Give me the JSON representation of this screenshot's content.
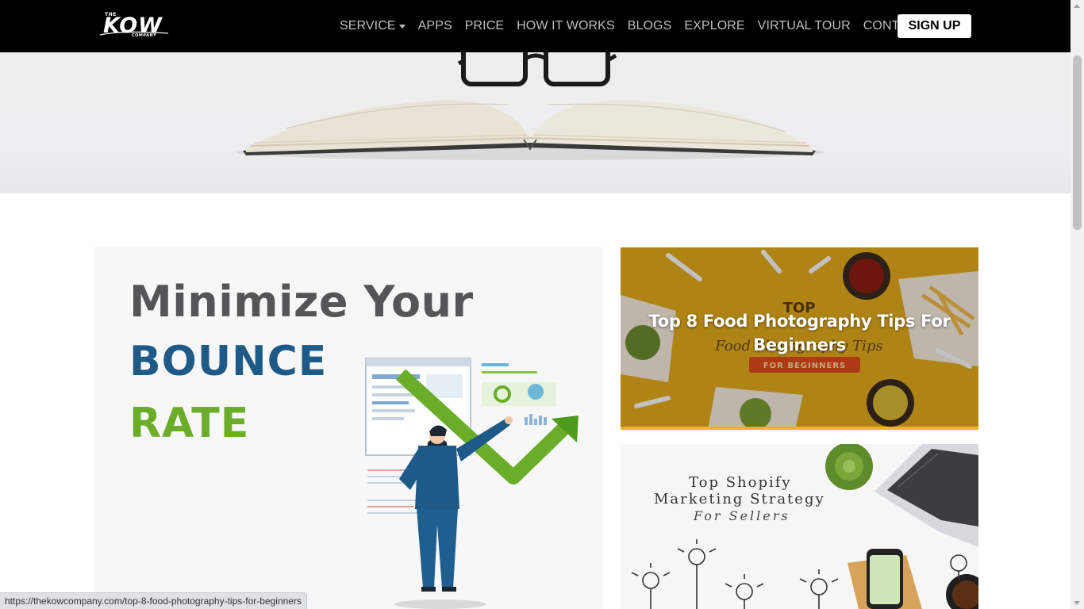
{
  "navbar": {
    "logo": {
      "the": "THE",
      "name": "KOW",
      "company": "COMPANY"
    },
    "links": [
      {
        "label": "SERVICE",
        "has_dropdown": true
      },
      {
        "label": "APPS"
      },
      {
        "label": "PRICE"
      },
      {
        "label": "HOW IT WORKS"
      },
      {
        "label": "BLOGS"
      },
      {
        "label": "EXPLORE"
      },
      {
        "label": "VIRTUAL TOUR"
      },
      {
        "label": "CONTACT"
      }
    ],
    "signup_label": "SIGN UP"
  },
  "hero": {
    "image": "open-book-with-glasses"
  },
  "main_post": {
    "line1": "Minimize Your",
    "line2": "BOUNCE",
    "line3": "RATE",
    "colors": {
      "line1": "#555558",
      "line2": "#1e5a87",
      "line3": "#6aad29"
    }
  },
  "side_posts": [
    {
      "title": "Top 8 Food Photography Tips For Beginners",
      "image_text": "TOP",
      "image_sub": "Food Photography Tips",
      "badge": "FOR BEGINNERS"
    },
    {
      "line1": "Top Shopify",
      "line2": "Marketing Strategy",
      "line3": "For Sellers"
    }
  ],
  "status_bar": {
    "url": "https://thekowcompany.com/top-8-food-photography-tips-for-beginners"
  },
  "colors": {
    "navbar_bg": "#000000",
    "nav_text": "#bfbfbf",
    "signup_bg": "#ffffff"
  }
}
